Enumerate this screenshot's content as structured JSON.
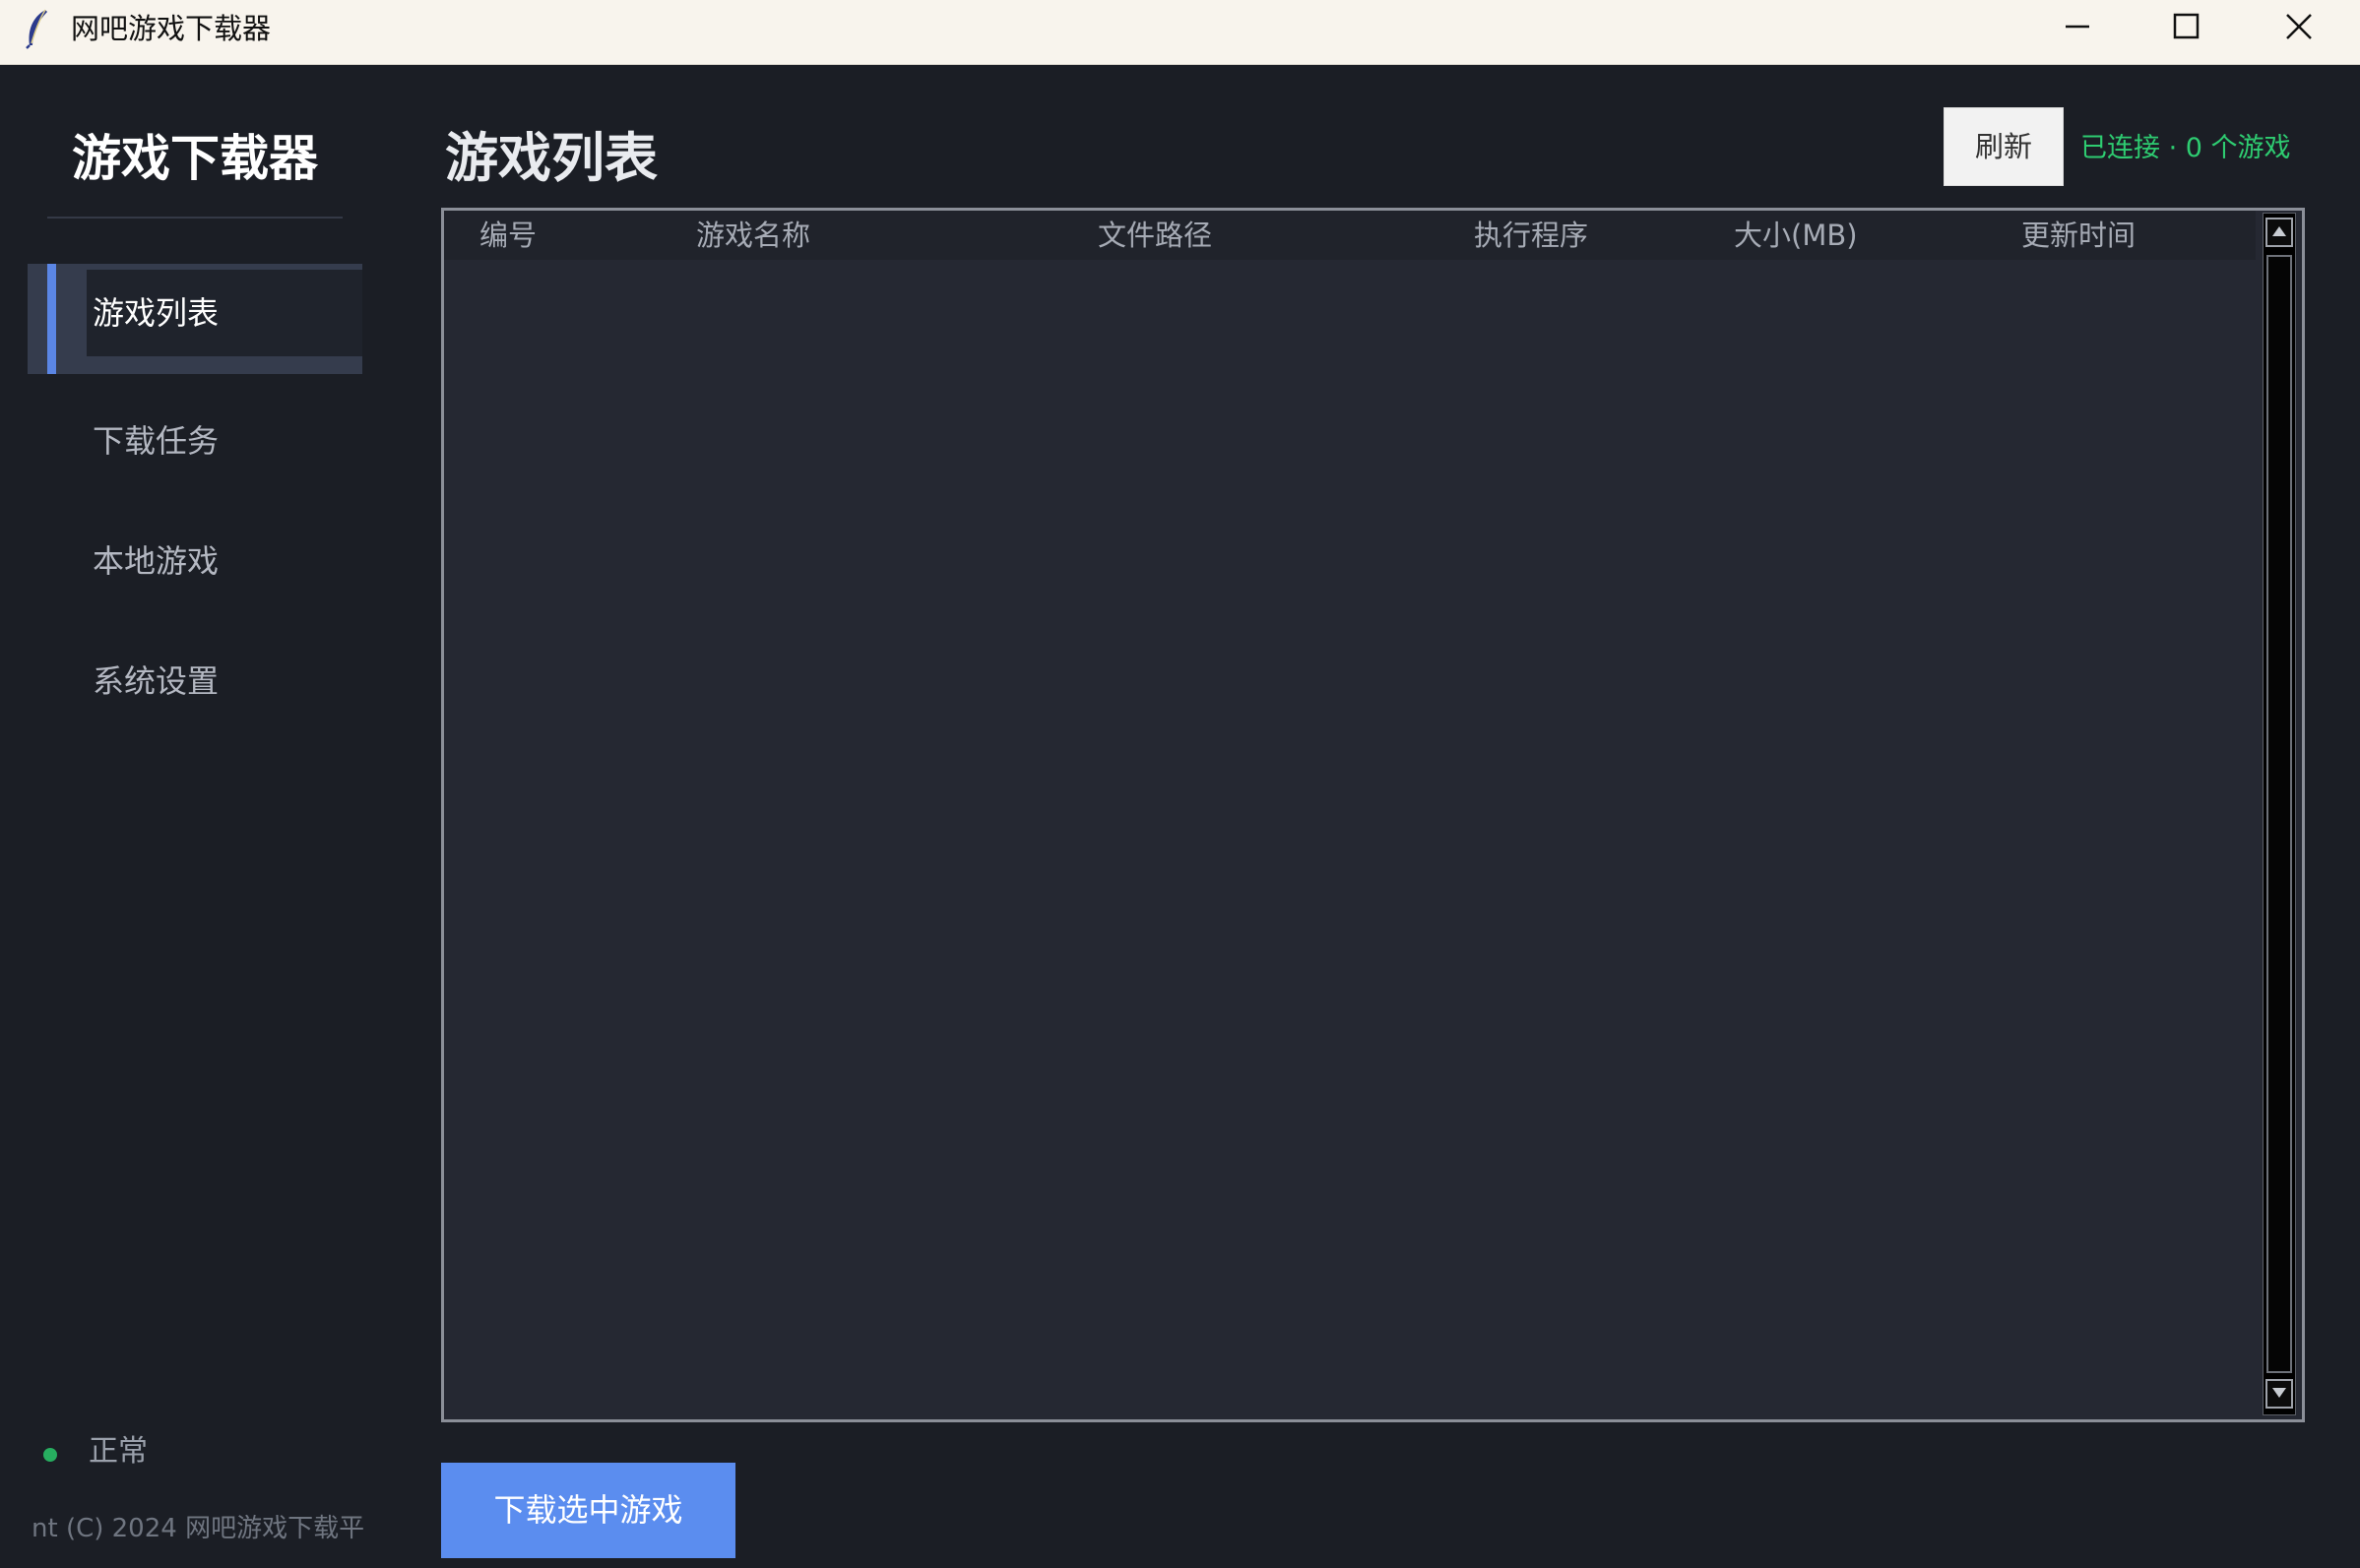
{
  "window": {
    "title": "网吧游戏下载器",
    "controls": {
      "minimize_icon": "minimize-icon",
      "maximize_icon": "maximize-icon",
      "close_icon": "close-icon"
    }
  },
  "sidebar": {
    "brand": "游戏下载器",
    "items": [
      {
        "label": "游戏列表",
        "active": true
      },
      {
        "label": "下载任务",
        "active": false
      },
      {
        "label": "本地游戏",
        "active": false
      },
      {
        "label": "系统设置",
        "active": false
      }
    ],
    "status_text": "正常",
    "status_color": "#27ae60",
    "copyright": "nt (C) 2024 网吧游戏下载平"
  },
  "main": {
    "title": "游戏列表",
    "refresh_label": "刷新",
    "connection_status": "已连接 · 0 个游戏",
    "connection_color": "#2ecc71",
    "table": {
      "columns": [
        "编号",
        "游戏名称",
        "文件路径",
        "执行程序",
        "大小(MB)",
        "更新时间"
      ],
      "rows": []
    },
    "download_label": "下载选中游戏",
    "accent_color": "#5b8def"
  }
}
